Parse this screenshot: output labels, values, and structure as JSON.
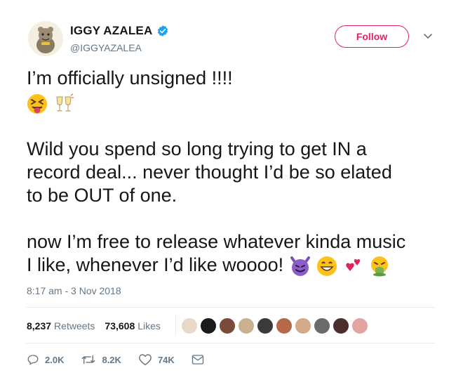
{
  "user": {
    "display_name": "IGGY AZALEA",
    "handle": "@IGGYAZALEA",
    "verified": true
  },
  "header": {
    "follow_label": "Follow"
  },
  "tweet": {
    "line1": "I’m officially unsigned !!!!",
    "line2a": "Wild you spend so long trying to get IN a",
    "line2b": "record deal... never thought I’d be so elated",
    "line2c": "to be OUT of one.",
    "line3a": "now I’m free to release whatever kinda music",
    "line3b": "I like, whenever I’d like woooo!",
    "emoji_row1": [
      "squinting-tongue-face",
      "clinking-glasses"
    ],
    "emoji_row3": [
      "smiling-devil",
      "grinning-face",
      "two-hearts",
      "vomiting-face"
    ]
  },
  "meta": {
    "timestamp": "8:17 am - 3 Nov 2018"
  },
  "stats": {
    "retweets_count": "8,237",
    "retweets_label": "Retweets",
    "likes_count": "73,608",
    "likes_label": "Likes"
  },
  "actions": {
    "replies": "2.0K",
    "retweets": "8.2K",
    "likes": "74K"
  },
  "colors": {
    "accent": "#e0245e",
    "verified": "#1da1f2",
    "muted": "#657786",
    "divider": "#e6ecf0"
  }
}
